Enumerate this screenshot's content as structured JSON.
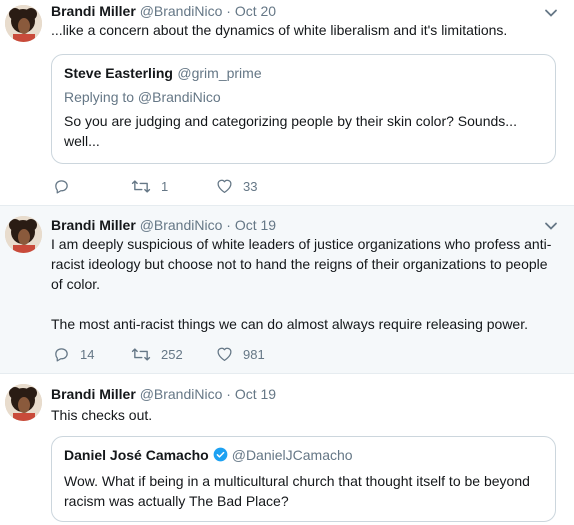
{
  "tweets": [
    {
      "name": "Brandi Miller",
      "handle": "@BrandiNico",
      "dot": "·",
      "time": "Oct 20",
      "text": "...like a concern about the dynamics of white liberalism and it's limitations.",
      "quote": {
        "name": "Steve Easterling",
        "handle": "@grim_prime",
        "replying": "Replying to @BrandiNico",
        "text": "So you are judging and categorizing people by their skin color? Sounds... well..."
      },
      "replies": "",
      "retweets": "1",
      "likes": "33"
    },
    {
      "name": "Brandi Miller",
      "handle": "@BrandiNico",
      "dot": "·",
      "time": "Oct 19",
      "text_p1": "I am deeply suspicious of white leaders of justice organizations who profess anti-racist ideology but choose not to hand the reigns of their organizations to people of color.",
      "text_p2": "The most anti-racist things we can do almost always require releasing power.",
      "replies": "14",
      "retweets": "252",
      "likes": "981"
    },
    {
      "name": "Brandi Miller",
      "handle": "@BrandiNico",
      "dot": "·",
      "time": "Oct 19",
      "text": "This checks out.",
      "quote": {
        "name": "Daniel José Camacho",
        "handle": "@DanielJCamacho",
        "text": "Wow. What if being in a multicultural church that thought itself to be beyond racism was actually The Bad Place?"
      }
    }
  ],
  "colors": {
    "accent": "#1da1f2",
    "muted": "#657786",
    "border": "#e6ecf0",
    "highlight_bg": "#f5f8fa"
  },
  "icons": [
    "reply-icon",
    "retweet-icon",
    "like-icon",
    "chevron-down-icon",
    "verified-icon"
  ]
}
